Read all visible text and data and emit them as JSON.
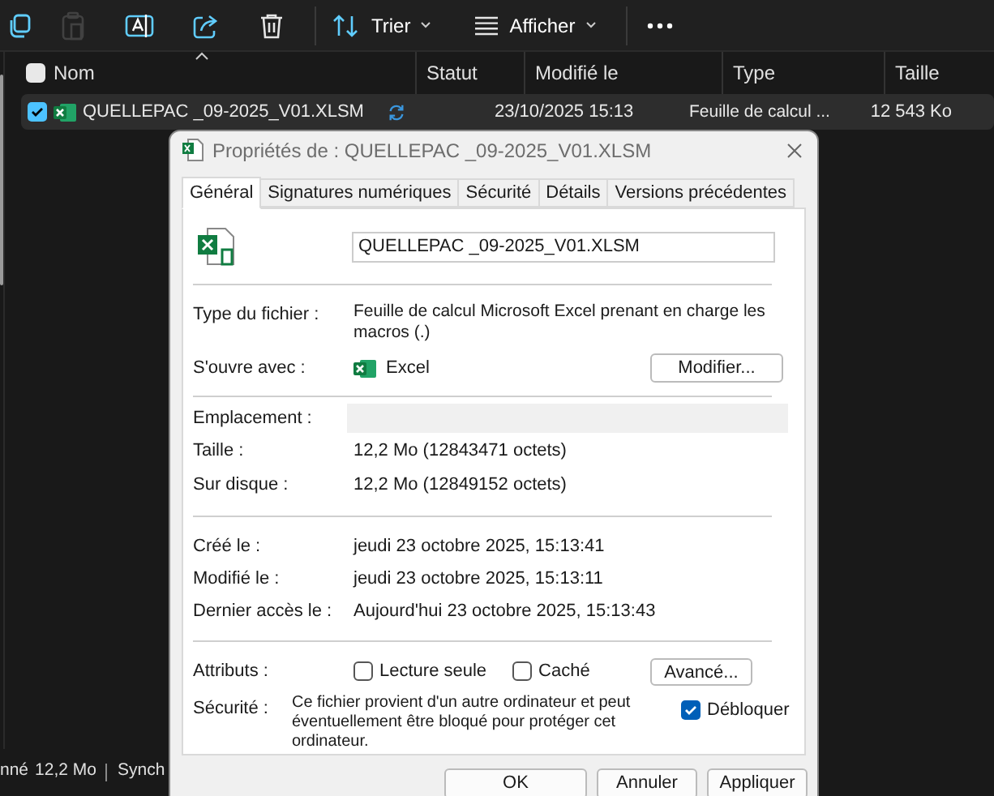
{
  "toolbar": {
    "buttons": [
      {
        "kind": "copy",
        "disabled": false
      },
      {
        "kind": "paste",
        "disabled": true
      },
      {
        "kind": "rename",
        "disabled": false
      },
      {
        "kind": "share",
        "disabled": false
      },
      {
        "kind": "delete",
        "disabled": false
      }
    ],
    "sort": "Trier",
    "view": "Afficher"
  },
  "file_list": {
    "select_all": {
      "checked": false
    },
    "columns": [
      "Nom",
      "Statut",
      "Modifié le",
      "Type",
      "Taille"
    ],
    "rows": [
      {
        "name": "QUELLEPAC _09-2025_V01.XLSM",
        "selected": true,
        "modified": "23/10/2025 15:13",
        "type": "Feuille de calcul ...",
        "size": "12 543 Ko"
      }
    ]
  },
  "status_bar": [
    "nné",
    "12,2 Mo",
    "Synch"
  ],
  "dialog": {
    "title": "Propriétés de : QUELLEPAC _09-2025_V01.XLSM",
    "tabs": [
      {
        "label": "Général",
        "selected": true
      },
      {
        "label": "Signatures numériques",
        "selected": false
      },
      {
        "label": "Sécurité",
        "selected": false
      },
      {
        "label": "Détails",
        "selected": false
      },
      {
        "label": "Versions précédentes",
        "selected": false
      }
    ],
    "file_name": "QUELLEPAC _09-2025_V01.XLSM",
    "file_type_label": "Type du fichier :",
    "file_type": "Feuille de calcul Microsoft Excel prenant en charge les macros (.)",
    "opens_with_label": "S'ouvre avec :",
    "opens_with": "Excel",
    "change_button": "Modifier...",
    "location_label": "Emplacement :",
    "size_rows": [
      {
        "label": "Taille :",
        "value": "12,2 Mo (12843471 octets)"
      },
      {
        "label": "Sur disque :",
        "value": "12,2 Mo (12849152 octets)"
      }
    ],
    "date_rows": [
      {
        "label": "Créé le :",
        "value": "jeudi 23 octobre 2025, 15:13:41"
      },
      {
        "label": "Modifié le :",
        "value": "jeudi 23 octobre 2025, 15:13:11"
      },
      {
        "label": "Dernier accès le :",
        "value": "Aujourd'hui 23 octobre 2025, 15:13:43"
      }
    ],
    "attributes_label": "Attributs :",
    "attributes": [
      {
        "label": "Lecture seule",
        "checked": false
      },
      {
        "label": "Caché",
        "checked": false
      }
    ],
    "advanced_button": "Avancé...",
    "security_label": "Sécurité :",
    "security_text": "Ce fichier provient d'un autre ordinateur et peut éventuellement être bloqué pour protéger cet ordinateur.",
    "unblock": {
      "label": "Débloquer",
      "checked": true
    },
    "buttons": [
      "OK",
      "Annuler",
      "Appliquer"
    ]
  }
}
